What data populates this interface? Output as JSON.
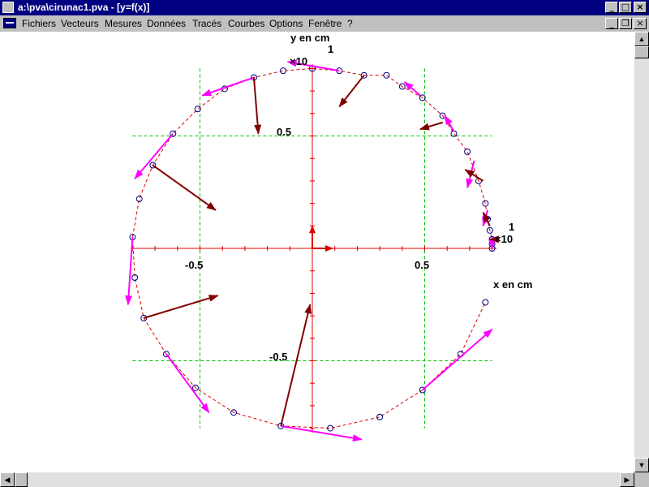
{
  "window": {
    "title": "a:\\pva\\cirunac1.pva - [y=f(x)]",
    "buttons": [
      "_",
      "□",
      "×"
    ]
  },
  "menubar": {
    "items": [
      {
        "label": "Fichiers"
      },
      {
        "label": "Vecteurs"
      },
      {
        "label": "Mesures"
      },
      {
        "label": "Données"
      },
      {
        "label": "Tracés"
      },
      {
        "label": "Courbes"
      },
      {
        "label": "Options"
      },
      {
        "label": "Fenêtre"
      },
      {
        "label": "?"
      }
    ],
    "doc_buttons": [
      "_",
      "❐",
      "×"
    ]
  },
  "plot": {
    "y_axis_label": "y en cm",
    "x_axis_label": "x en cm",
    "y_scale_exponent": "1",
    "y_scale_prefix": "×10",
    "x_scale_exponent": "1",
    "x_scale_prefix": "×10",
    "x_tick_neg": "-0.5",
    "x_tick_pos": "0.5",
    "y_tick_pos": "0.5",
    "y_tick_neg": "-0.5",
    "colors": {
      "axes": "#e00000",
      "grid": "#00c000",
      "trajectory": "#e00000",
      "points": "#000080",
      "velocity_vectors": "#ff00ff",
      "acceleration_vectors": "#800000"
    }
  },
  "chart_data": {
    "type": "scatter",
    "title": "",
    "xlabel": "x en cm",
    "ylabel": "y en cm",
    "xlim": [
      -0.82,
      0.92
    ],
    "ylim": [
      -0.82,
      0.82
    ],
    "grid": true,
    "points": [
      {
        "x": 0.8,
        "y": 0.0
      },
      {
        "x": 0.8,
        "y": 0.02
      },
      {
        "x": 0.8,
        "y": 0.04
      },
      {
        "x": 0.79,
        "y": 0.08
      },
      {
        "x": 0.78,
        "y": 0.13
      },
      {
        "x": 0.77,
        "y": 0.2
      },
      {
        "x": 0.74,
        "y": 0.3
      },
      {
        "x": 0.69,
        "y": 0.43
      },
      {
        "x": 0.63,
        "y": 0.51
      },
      {
        "x": 0.58,
        "y": 0.59
      },
      {
        "x": 0.49,
        "y": 0.67
      },
      {
        "x": 0.4,
        "y": 0.72
      },
      {
        "x": 0.33,
        "y": 0.77
      },
      {
        "x": 0.23,
        "y": 0.77
      },
      {
        "x": 0.12,
        "y": 0.79
      },
      {
        "x": 0.0,
        "y": 0.8
      },
      {
        "x": -0.13,
        "y": 0.79
      },
      {
        "x": -0.26,
        "y": 0.76
      },
      {
        "x": -0.39,
        "y": 0.71
      },
      {
        "x": -0.51,
        "y": 0.62
      },
      {
        "x": -0.62,
        "y": 0.51
      },
      {
        "x": -0.71,
        "y": 0.37
      },
      {
        "x": -0.77,
        "y": 0.22
      },
      {
        "x": -0.8,
        "y": 0.05
      },
      {
        "x": -0.79,
        "y": -0.13
      },
      {
        "x": -0.75,
        "y": -0.31
      },
      {
        "x": -0.65,
        "y": -0.47
      },
      {
        "x": -0.52,
        "y": -0.62
      },
      {
        "x": -0.35,
        "y": -0.73
      },
      {
        "x": -0.14,
        "y": -0.79
      },
      {
        "x": 0.08,
        "y": -0.8
      },
      {
        "x": 0.3,
        "y": -0.75
      },
      {
        "x": 0.49,
        "y": -0.63
      },
      {
        "x": 0.66,
        "y": -0.47
      },
      {
        "x": 0.77,
        "y": -0.24
      }
    ],
    "velocity_vectors": [
      {
        "x": 0.8,
        "y": 0.05,
        "dx": 0.0,
        "dy": -0.05
      },
      {
        "x": 0.78,
        "y": 0.17,
        "dx": -0.02,
        "dy": -0.07
      },
      {
        "x": 0.72,
        "y": 0.39,
        "dx": -0.03,
        "dy": -0.12
      },
      {
        "x": 0.63,
        "y": 0.52,
        "dx": -0.04,
        "dy": 0.07
      },
      {
        "x": 0.48,
        "y": 0.68,
        "dx": -0.07,
        "dy": 0.06
      },
      {
        "x": 0.12,
        "y": 0.79,
        "dx": -0.23,
        "dy": 0.04
      },
      {
        "x": -0.26,
        "y": 0.76,
        "dx": -0.23,
        "dy": -0.08
      },
      {
        "x": -0.62,
        "y": 0.51,
        "dx": -0.17,
        "dy": -0.2
      },
      {
        "x": -0.8,
        "y": 0.05,
        "dx": -0.02,
        "dy": -0.3
      },
      {
        "x": -0.65,
        "y": -0.47,
        "dx": 0.19,
        "dy": -0.26
      },
      {
        "x": -0.14,
        "y": -0.79,
        "dx": 0.36,
        "dy": -0.06
      },
      {
        "x": 0.49,
        "y": -0.63,
        "dx": 0.31,
        "dy": 0.27
      }
    ],
    "acceleration_vectors": [
      {
        "x": 0.8,
        "y": 0.04,
        "dx": -0.01,
        "dy": 0.0
      },
      {
        "x": 0.79,
        "y": 0.1,
        "dx": -0.03,
        "dy": 0.06
      },
      {
        "x": 0.76,
        "y": 0.3,
        "dx": -0.08,
        "dy": 0.05
      },
      {
        "x": 0.58,
        "y": 0.56,
        "dx": -0.1,
        "dy": -0.03
      },
      {
        "x": 0.23,
        "y": 0.77,
        "dx": -0.11,
        "dy": -0.14
      },
      {
        "x": -0.26,
        "y": 0.76,
        "dx": 0.02,
        "dy": -0.25
      },
      {
        "x": -0.71,
        "y": 0.37,
        "dx": 0.28,
        "dy": -0.2
      },
      {
        "x": -0.75,
        "y": -0.31,
        "dx": 0.33,
        "dy": 0.1
      },
      {
        "x": -0.14,
        "y": -0.79,
        "dx": 0.13,
        "dy": 0.54
      },
      {
        "x": 0.0,
        "y": 0.0,
        "dx": 0.0,
        "dy": 0.1
      },
      {
        "x": 0.0,
        "y": 0.0,
        "dx": 0.09,
        "dy": 0.0
      }
    ]
  }
}
